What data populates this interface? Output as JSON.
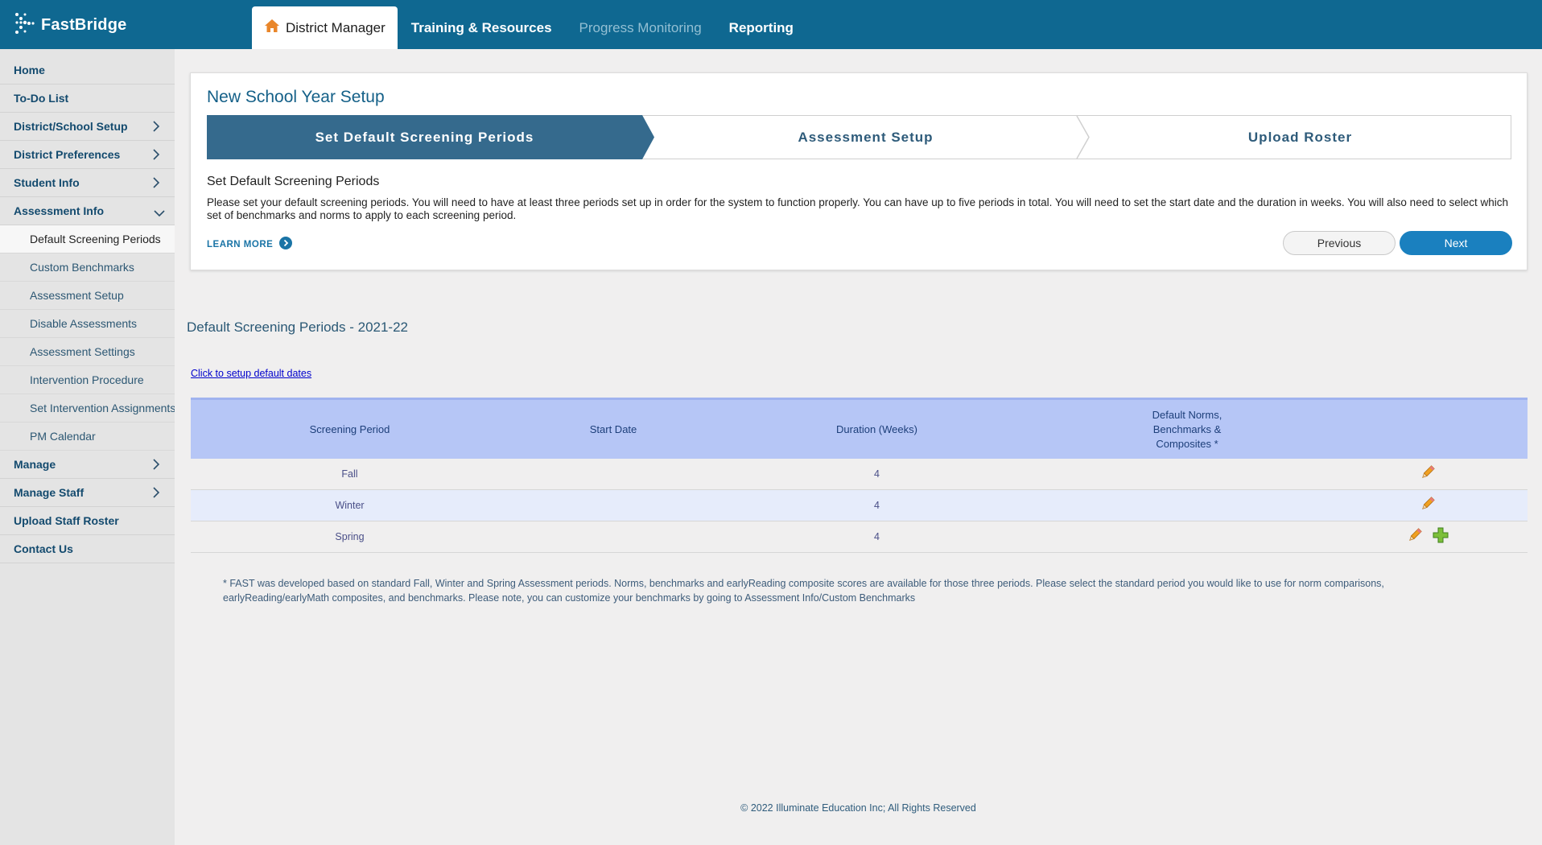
{
  "brand": {
    "name": "FastBridge",
    "color": "#0f6891",
    "icon": "fastbridge-logo-icon"
  },
  "nav": {
    "tabs": [
      {
        "label": "District Manager",
        "active": true,
        "icon": "home-icon"
      },
      {
        "label": "Training & Resources"
      },
      {
        "label": "Progress Monitoring",
        "disabled": true
      },
      {
        "label": "Reporting"
      }
    ]
  },
  "sidebar": {
    "items": [
      {
        "label": "Home"
      },
      {
        "label": "To-Do List"
      },
      {
        "label": "District/School Setup",
        "icon": "chevron-right-icon"
      },
      {
        "label": "District Preferences",
        "icon": "chevron-right-icon"
      },
      {
        "label": "Student Info",
        "icon": "chevron-right-icon"
      },
      {
        "label": "Assessment Info",
        "icon": "chevron-down-icon",
        "expanded": true
      }
    ],
    "subitems": [
      {
        "label": "Default Screening Periods",
        "active": true
      },
      {
        "label": "Custom Benchmarks"
      },
      {
        "label": "Assessment Setup"
      },
      {
        "label": "Disable Assessments"
      },
      {
        "label": "Assessment Settings"
      },
      {
        "label": "Intervention Procedure"
      },
      {
        "label": "Set Intervention Assignments"
      },
      {
        "label": "PM Calendar"
      }
    ],
    "items_after": [
      {
        "label": "Manage",
        "icon": "chevron-right-icon"
      },
      {
        "label": "Manage Staff",
        "icon": "chevron-right-icon"
      },
      {
        "label": "Upload Staff Roster"
      },
      {
        "label": "Contact Us"
      }
    ]
  },
  "setup": {
    "title": "New School Year Setup",
    "steps": [
      {
        "label": "Set Default Screening Periods",
        "active": true
      },
      {
        "label": "Assessment Setup"
      },
      {
        "label": "Upload Roster"
      }
    ],
    "desc_title": "Set Default Screening Periods",
    "description": "Please set your default screening periods. You will need to have at least three periods set up in order for the system to function properly. You can have up to five periods in total. You will need to set the start date and the duration in weeks. You will also need to select which set of benchmarks and norms to apply to each screening period.",
    "learn_more": "LEARN MORE",
    "previous_label": "Previous",
    "next_label": "Next",
    "accent": "#1a80bf"
  },
  "section": {
    "title": "Default Screening Periods - 2021-22",
    "setup_link": "Click to setup default dates"
  },
  "table": {
    "headers": {
      "period": "Screening Period",
      "start": "Start Date",
      "duration": "Duration (Weeks)",
      "norms_line1": "Default Norms,",
      "norms_line2": "Benchmarks &",
      "norms_line3": "Composites *"
    },
    "rows": [
      {
        "period": "Fall",
        "start": "",
        "duration": "4",
        "norms": "",
        "actions": [
          "pencil-icon"
        ]
      },
      {
        "period": "Winter",
        "start": "",
        "duration": "4",
        "norms": "",
        "actions": [
          "pencil-icon"
        ]
      },
      {
        "period": "Spring",
        "start": "",
        "duration": "4",
        "norms": "",
        "actions": [
          "pencil-icon",
          "plus-icon"
        ]
      }
    ],
    "header_color": "#b6c6f6",
    "alt_row_color": "#e6ecfb"
  },
  "note": "* FAST was developed based on standard Fall, Winter and Spring Assessment periods. Norms, benchmarks and earlyReading composite scores are available for those three periods. Please select the standard period you would like to use for norm comparisons, earlyReading/earlyMath composites, and benchmarks. Please note, you can customize your benchmarks by going to Assessment Info/Custom Benchmarks",
  "footer": "© 2022 Illuminate Education Inc; All Rights Reserved"
}
